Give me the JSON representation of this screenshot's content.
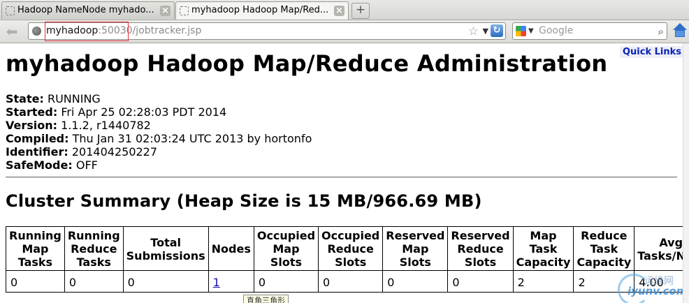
{
  "browser": {
    "tabs": [
      {
        "title": "Hadoop NameNode myhado...",
        "active": false
      },
      {
        "title": "myhadoop Hadoop Map/Red...",
        "active": true
      }
    ],
    "address": {
      "host": "myhadoop",
      "rest": ":50030/jobtracker.jsp"
    },
    "search_placeholder": "Google"
  },
  "page": {
    "quick_links": "Quick Links",
    "title": "myhadoop Hadoop Map/Reduce Administration",
    "info": [
      {
        "label": "State:",
        "value": "RUNNING"
      },
      {
        "label": "Started:",
        "value": "Fri Apr 25 02:28:03 PDT 2014"
      },
      {
        "label": "Version:",
        "value": "1.1.2, r1440782"
      },
      {
        "label": "Compiled:",
        "value": "Thu Jan 31 02:03:24 UTC 2013 by hortonfo"
      },
      {
        "label": "Identifier:",
        "value": "201404250227"
      },
      {
        "label": "SafeMode:",
        "value": "OFF"
      }
    ],
    "summary_heading": "Cluster Summary (Heap Size is 15 MB/966.69 MB)",
    "summary_table": {
      "headers": [
        [
          "Running",
          "Map",
          "Tasks"
        ],
        [
          "Running",
          "Reduce",
          "Tasks"
        ],
        [
          "Total",
          "Submissions"
        ],
        [
          "Nodes"
        ],
        [
          "Occupied",
          "Map",
          "Slots"
        ],
        [
          "Occupied",
          "Reduce",
          "Slots"
        ],
        [
          "Reserved",
          "Map",
          "Slots"
        ],
        [
          "Reserved",
          "Reduce",
          "Slots"
        ],
        [
          "Map",
          "Task",
          "Capacity"
        ],
        [
          "Reduce",
          "Task",
          "Capacity"
        ],
        [
          "Avg.",
          "Tasks/Node"
        ]
      ],
      "row": [
        "0",
        "0",
        "0",
        "1",
        "0",
        "0",
        "0",
        "0",
        "2",
        "2",
        "4.00"
      ]
    },
    "tooltip": "直角三角形",
    "watermark": {
      "cn": "运维网",
      "site": "iyunv.com"
    }
  }
}
